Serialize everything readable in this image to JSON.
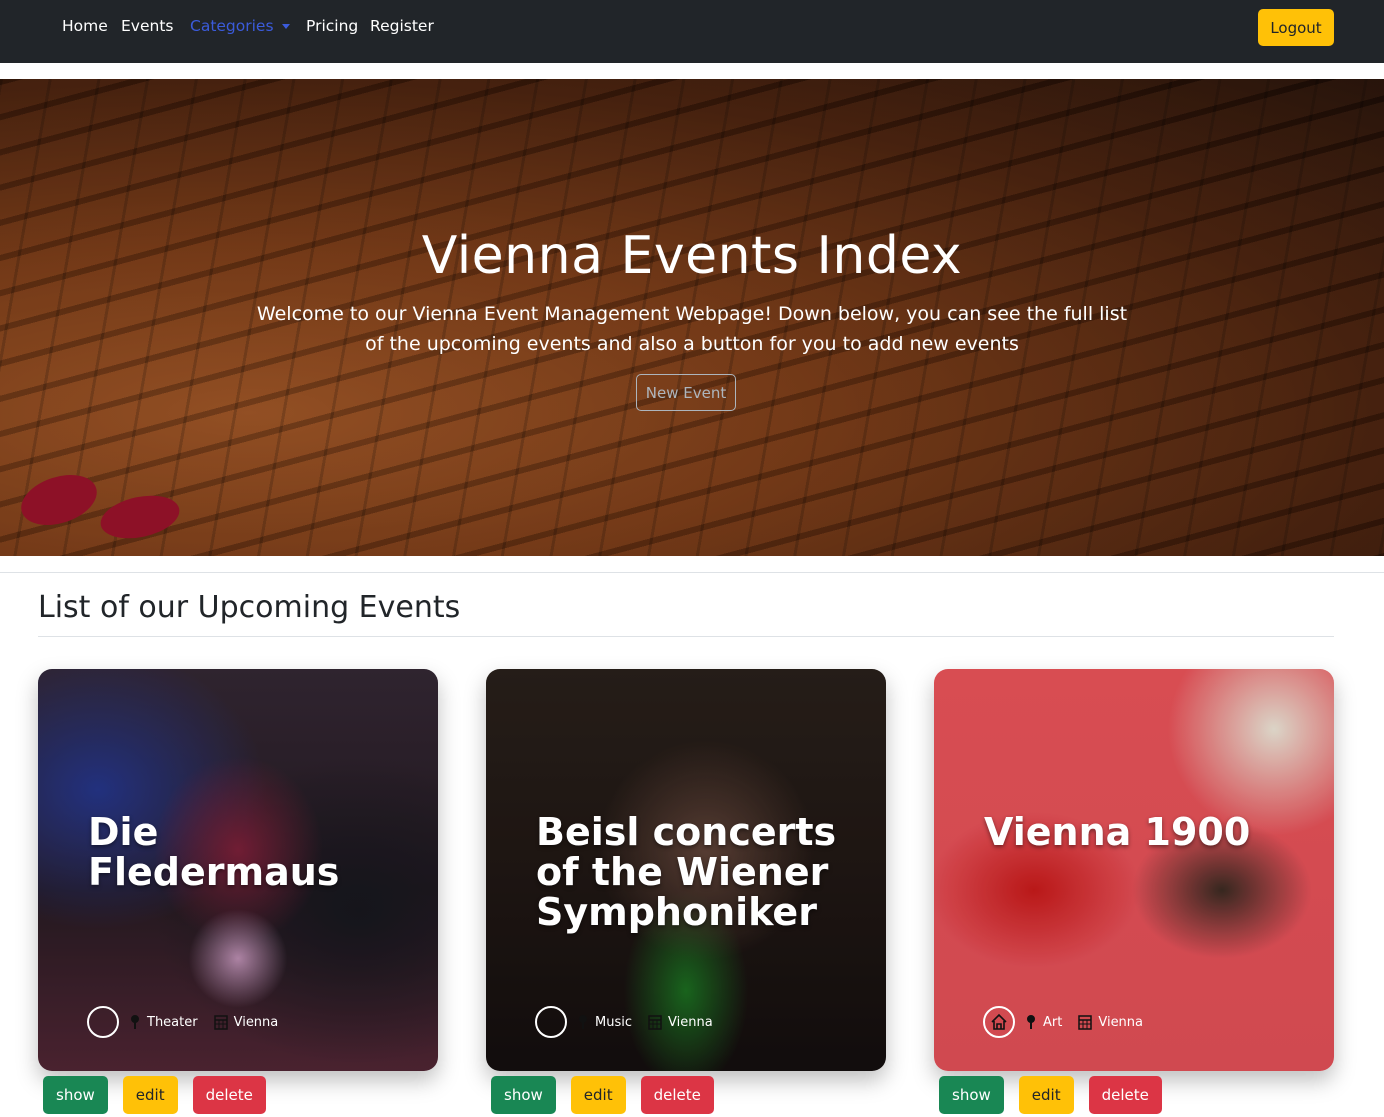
{
  "nav": {
    "items": [
      {
        "label": "Home"
      },
      {
        "label": "Events"
      },
      {
        "label": "Categories"
      },
      {
        "label": "Pricing"
      },
      {
        "label": "Register"
      }
    ],
    "logout_label": "Logout"
  },
  "hero": {
    "title": "Vienna Events Index",
    "lead": "Welcome to our Vienna Event Management Webpage! Down below, you can see the full list of the upcoming events and also a button for you to add new events",
    "new_event_label": "New Event"
  },
  "section": {
    "title": "List of our Upcoming Events"
  },
  "events": [
    {
      "title": "Die Fledermaus",
      "category": "Theater",
      "location": "Vienna"
    },
    {
      "title": "Beisl concerts of the Wiener Symphoniker",
      "category": "Music",
      "location": "Vienna"
    },
    {
      "title": "Vienna 1900",
      "category": "Art",
      "location": "Vienna"
    }
  ],
  "card_actions": {
    "show_label": "show",
    "edit_label": "edit",
    "delete_label": "delete"
  },
  "colors": {
    "navbar": "#212529",
    "accent_warning": "#ffc107",
    "success": "#198754",
    "danger": "#dc3545",
    "active_link": "#3b5bdb"
  }
}
